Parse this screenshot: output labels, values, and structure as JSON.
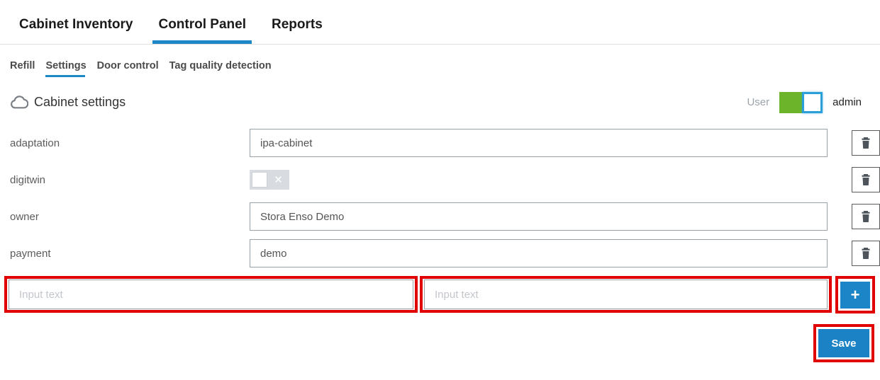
{
  "tabs": {
    "items": [
      {
        "label": "Cabinet Inventory",
        "active": false
      },
      {
        "label": "Control Panel",
        "active": true
      },
      {
        "label": "Reports",
        "active": false
      }
    ]
  },
  "subtabs": {
    "items": [
      {
        "label": "Refill",
        "active": false
      },
      {
        "label": "Settings",
        "active": true
      },
      {
        "label": "Door control",
        "active": false
      },
      {
        "label": "Tag quality detection",
        "active": false
      }
    ]
  },
  "header": {
    "icon": "cloud-icon",
    "title": "Cabinet settings",
    "user_label": "User",
    "user_toggle_state": "on",
    "user_value": "admin"
  },
  "form": {
    "rows": [
      {
        "label": "adaptation",
        "type": "text",
        "value": "ipa-cabinet",
        "action_icon": "trash-icon"
      },
      {
        "label": "digitwin",
        "type": "toggle",
        "value": "off",
        "toggle_glyph": "✕",
        "action_icon": "trash-icon"
      },
      {
        "label": "owner",
        "type": "text",
        "value": "Stora Enso Demo",
        "action_icon": "trash-icon"
      },
      {
        "label": "payment",
        "type": "text",
        "value": "demo",
        "action_icon": "trash-icon"
      }
    ],
    "new_row": {
      "key_placeholder": "Input text",
      "value_placeholder": "Input text",
      "add_label": "+"
    },
    "save_label": "Save"
  },
  "colors": {
    "accent_blue": "#1c85c7",
    "toggle_green": "#6cb52b",
    "toggle_border_blue": "#2b9fd8",
    "highlight_red": "#e00000"
  }
}
